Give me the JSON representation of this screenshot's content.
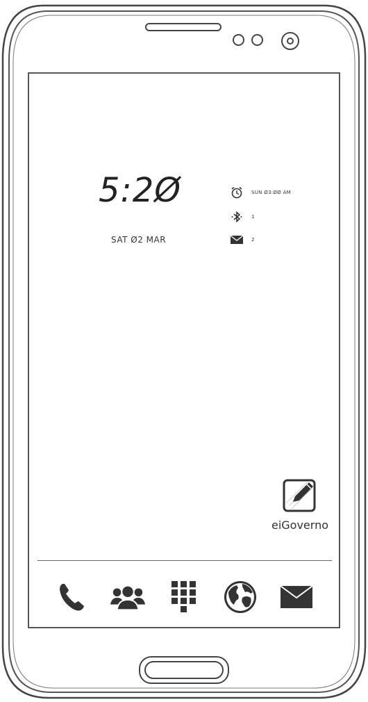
{
  "lockscreen": {
    "time": "5:2Ø",
    "date": "SAT Ø2 MAR"
  },
  "status": {
    "alarm": {
      "icon": "alarm-clock-icon",
      "text": "SUN Ø3:ØØ AM"
    },
    "bluetooth": {
      "icon": "bluetooth-icon",
      "text": "1"
    },
    "messages": {
      "icon": "envelope-icon",
      "text": "2"
    }
  },
  "app_shortcut": {
    "icon": "edit-note-icon",
    "label": "eiGoverno"
  },
  "dock": [
    {
      "icon": "phone-icon"
    },
    {
      "icon": "contacts-icon"
    },
    {
      "icon": "apps-grid-icon"
    },
    {
      "icon": "globe-icon"
    },
    {
      "icon": "mail-icon"
    }
  ],
  "colors": {
    "ink": "#333333",
    "frame": "#444444"
  }
}
